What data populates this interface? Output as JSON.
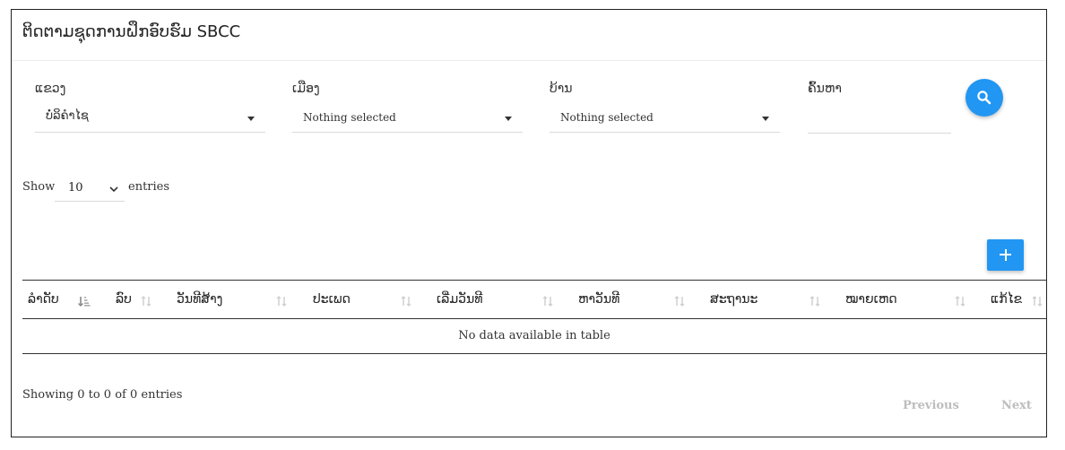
{
  "page": {
    "title": "ຕິດຕາມຊຸດການຝຶກອົບຮົມ SBCC"
  },
  "filters": {
    "province": {
      "label": "ແຂວງ",
      "value": "ບໍ່ລິຄຳໄຊ"
    },
    "district": {
      "label": "ເມືອງ",
      "value": "Nothing selected"
    },
    "village": {
      "label": "ບ້ານ",
      "value": "Nothing selected"
    },
    "search": {
      "label": "ຄົ້ນຫາ",
      "value": ""
    }
  },
  "length_menu": {
    "show": "Show",
    "value": "10",
    "entries": "entries"
  },
  "table": {
    "columns": [
      "ລຳດັບ",
      "ລົບ",
      "ວັນທີສ້າງ",
      "ປະເພດ",
      "ເລີ່ມວັນທີ",
      "ຫາວັນທີ",
      "ສະຖານະ",
      "ໝາຍເຫດ",
      "ແກ້ໄຂ"
    ],
    "empty_message": "No data available in table"
  },
  "footer": {
    "info": "Showing 0 to 0 of 0 entries",
    "previous": "Previous",
    "next": "Next"
  },
  "colors": {
    "accent": "#2196f3",
    "disabled": "#bdbdbd",
    "border": "#333333"
  },
  "icons": {
    "search_button": "search-icon",
    "add_button": "plus-icon",
    "dropdown": "caret-down-icon",
    "sort": "sort-icon"
  }
}
